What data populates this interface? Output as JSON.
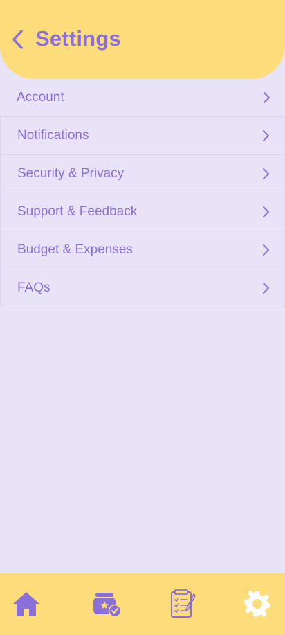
{
  "header": {
    "title": "Settings",
    "back_icon": "chevron-left-icon"
  },
  "menu": {
    "items": [
      {
        "label": "Account",
        "icon": "chevron-right-icon"
      },
      {
        "label": "Notifications",
        "icon": "chevron-right-icon"
      },
      {
        "label": "Security & Privacy",
        "icon": "chevron-right-icon"
      },
      {
        "label": "Support & Feedback",
        "icon": "chevron-right-icon"
      },
      {
        "label": "Budget & Expenses",
        "icon": "chevron-right-icon"
      },
      {
        "label": "FAQs",
        "icon": "chevron-right-icon"
      }
    ]
  },
  "bottom_nav": {
    "items": [
      {
        "icon": "home-icon"
      },
      {
        "icon": "event-calendar-check-icon"
      },
      {
        "icon": "checklist-notepad-icon"
      },
      {
        "icon": "gear-icon",
        "active": true
      }
    ]
  },
  "colors": {
    "background": "#E9E3F8",
    "header": "#FCDC7B",
    "accent": "#8B6FD8",
    "active_nav_icon": "#FFFFFF",
    "divider": "#DCD4EE"
  }
}
